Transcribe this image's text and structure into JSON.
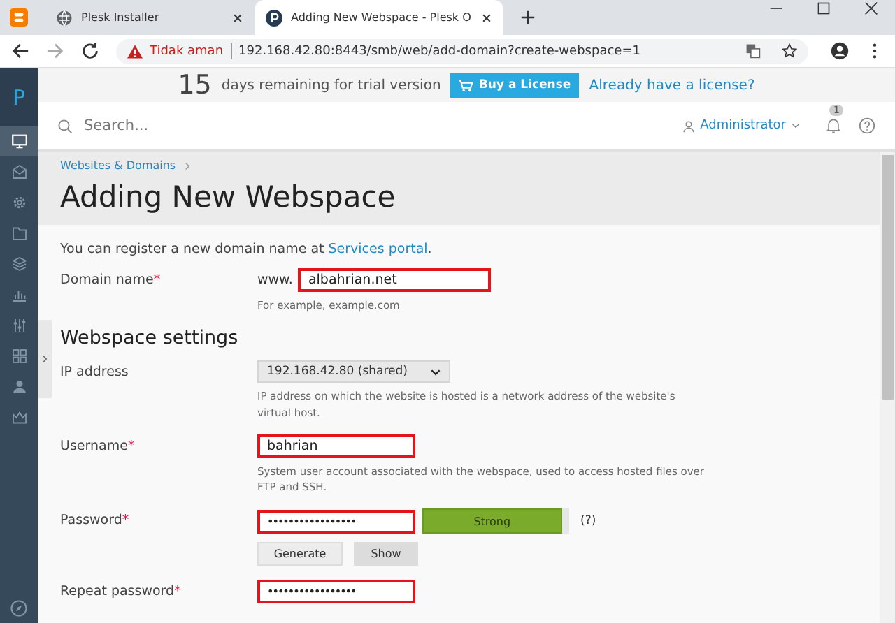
{
  "browser": {
    "tabs": [
      {
        "title": "Plesk Installer",
        "selected": false
      },
      {
        "title": "Adding New Webspace - Plesk O",
        "selected": true
      }
    ],
    "security": "Tidak aman",
    "url": "192.168.42.80:8443/smb/web/add-domain?create-webspace=1"
  },
  "sidebar": {
    "logo": "P",
    "items": [
      {
        "selected": true
      },
      {
        "selected": false
      },
      {
        "selected": false
      },
      {
        "selected": false
      },
      {
        "selected": false
      },
      {
        "selected": false
      },
      {
        "selected": false
      },
      {
        "selected": false
      },
      {
        "selected": false
      },
      {
        "selected": false
      }
    ]
  },
  "trial": {
    "days": "15",
    "text": "days remaining for trial version",
    "buy": "Buy a License",
    "link": "Already have a license?"
  },
  "header": {
    "search_placeholder": "Search...",
    "user": "Administrator",
    "notifications": "1"
  },
  "breadcrumb": "Websites & Domains",
  "title": "Adding New Webspace",
  "intro": {
    "text": "You can register a new domain name at ",
    "link": "Services portal",
    "end": "."
  },
  "domain": {
    "label": "Domain name",
    "required_mark": "*",
    "prefix": "www.",
    "value": "albahrian.net",
    "highlighted": true,
    "hint": "For example, example.com"
  },
  "section": "Webspace settings",
  "ip": {
    "label": "IP address",
    "value": "192.168.42.80 (shared)",
    "hint": "IP address on which the website is hosted is a network address of the website's virtual host."
  },
  "username": {
    "label": "Username",
    "required_mark": "*",
    "value": "bahrian",
    "highlighted": true,
    "hint": "System user account associated with the webspace, used to access hosted files over FTP and SSH."
  },
  "password": {
    "label": "Password",
    "required_mark": "*",
    "value": "•••••••••••••••••",
    "highlighted": true,
    "strength": "Strong",
    "level": 0.95,
    "help": "(?)",
    "buttons": [
      {
        "label": "Generate",
        "selected": false
      },
      {
        "label": "Show",
        "selected": true
      }
    ]
  },
  "repeat": {
    "label": "Repeat password",
    "required_mark": "*",
    "value": "•••••••••••••••••",
    "highlighted": true
  }
}
